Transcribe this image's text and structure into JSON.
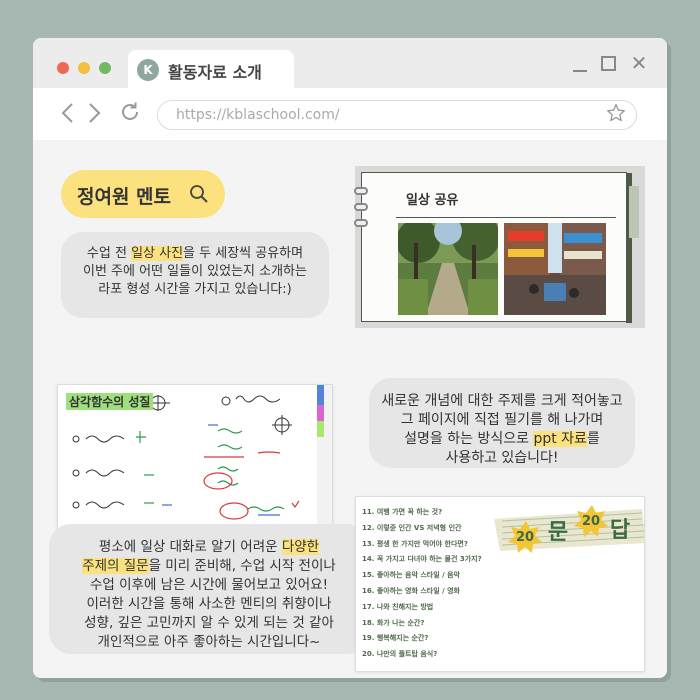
{
  "window": {
    "tab_icon_letter": "K",
    "tab_title": "활동자료 소개",
    "close_glyph": "✕"
  },
  "nav": {
    "url": "https://kblaschool.com/"
  },
  "mentor": {
    "name": "정여원 멘토"
  },
  "bubble1": {
    "line1_a": "수업 전 ",
    "line1_hl": "일상 사진",
    "line1_b": "을 두 세장씩 공유하며",
    "line2": "이번 주에 어떤 일들이 있었는지 소개하는",
    "line3": "라포 형성 시간을 가지고 있습니다:)"
  },
  "bubble2": {
    "line1": "새로운 개념에 대한 주제를 크게 적어놓고",
    "line2": "그 페이지에 직접 필기를 해 나가며",
    "line3_a": "설명을 하는 방식으로 ",
    "line3_hl": "ppt 자료",
    "line3_b": "를",
    "line4": "사용하고 있습니다!"
  },
  "bubble3": {
    "line1_a": "평소에 일상 대화로 알기 어려운 ",
    "line1_hl": "다양한",
    "line2_hl": "주제의 질문",
    "line2_b": "을 미리 준비해, 수업 시작 전이나",
    "line3": "수업 이후에 남은 시간에 물어보고 있어요!",
    "line4": "이러한 시간을 통해 사소한 멘티의 취향이나",
    "line5": "성향, 깊은 고민까지 알 수 있게 되는 것 같아",
    "line6": "개인적으로 아주 좋아하는 시간입니다~"
  },
  "photo_card": {
    "title": "일상 공유"
  },
  "note_card": {
    "title": "삼각함수의 성질"
  },
  "list_card": {
    "items": [
      "11. 여행 가면 꼭 하는 것?",
      "12. 이렇쥰 인간 VS 저녁형 인간",
      "13. 평생 한 가지만 먹어야 한다면?",
      "14. 꼭 가지고 다녀야 하는 물건 3가지?",
      "15. 좋아하는 음악 스타일 / 음악",
      "16. 좋아하는 영화 스타일 / 영화",
      "17. 나와 친해지는 방법",
      "18. 화가 나는 순간?",
      "19. 행복해지는 순간?",
      "20. 나만의 플트탑 음식?"
    ],
    "banner": {
      "left_num": "20",
      "char1": "문",
      "right_num": "20",
      "char2": "답"
    }
  },
  "colors": {
    "background": "#a6b8b1",
    "highlight": "#fbe27f",
    "bubble": "#e6e6e6",
    "dot_red": "#ee6a52",
    "dot_yellow": "#f4bf3e",
    "dot_green": "#72b966"
  },
  "icons": [
    "search-icon",
    "star-icon",
    "back-icon",
    "forward-icon",
    "reload-icon",
    "minimize-icon",
    "maximize-icon",
    "close-icon"
  ]
}
